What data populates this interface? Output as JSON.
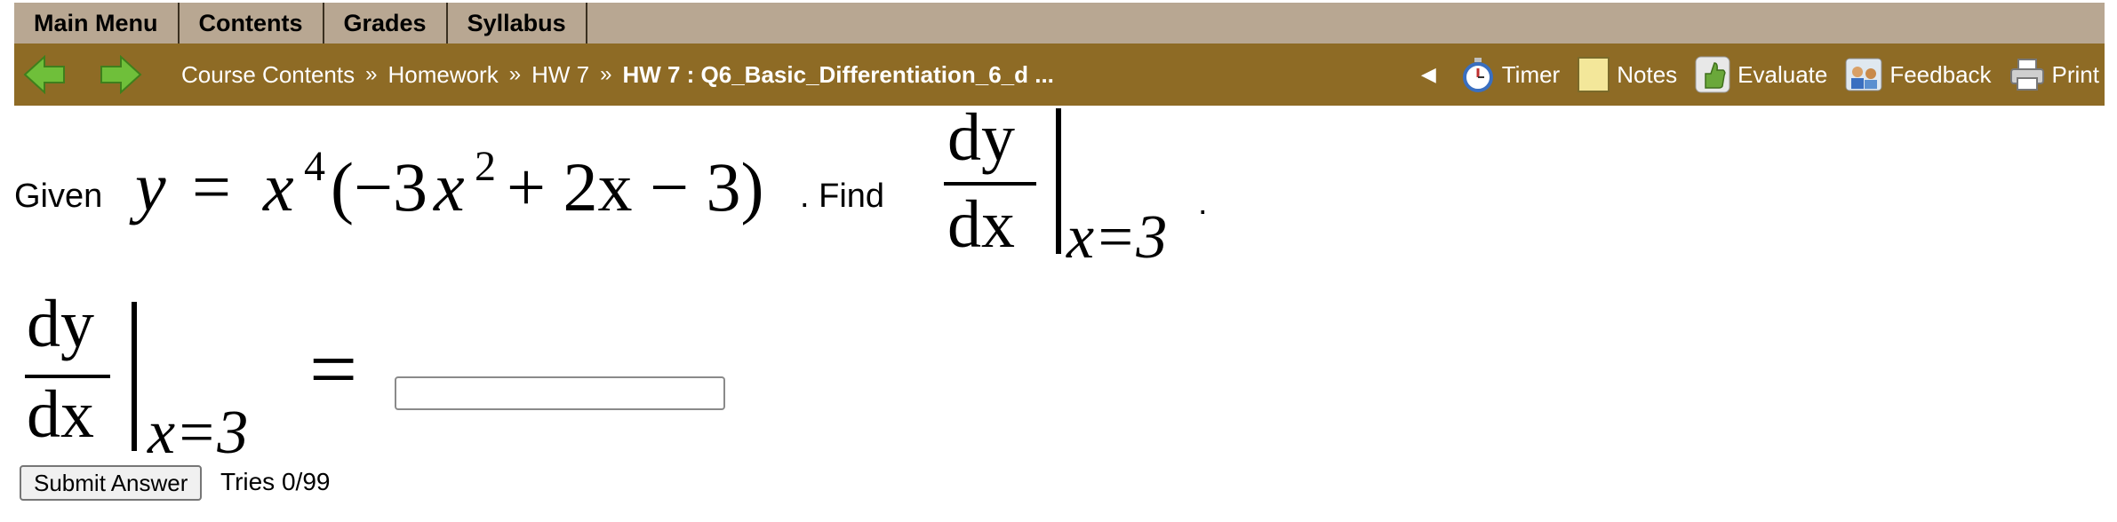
{
  "menu": {
    "items": [
      "Main Menu",
      "Contents",
      "Grades",
      "Syllabus"
    ]
  },
  "nav": {
    "breadcrumbs": [
      "Course Contents",
      "Homework",
      "HW 7"
    ],
    "separator": "»",
    "current": "HW 7 : Q6_Basic_Differentiation_6_d ...",
    "tools": {
      "timer": "Timer",
      "notes": "Notes",
      "evaluate": "Evaluate",
      "feedback": "Feedback",
      "print": "Print"
    }
  },
  "question": {
    "given_label": "Given",
    "find_label": ". Find",
    "period": ".",
    "equation": {
      "lhs": "y",
      "equals": "=",
      "base": "x",
      "exp": "4",
      "open": "(−3",
      "x2": "x",
      "exp2": "2",
      "rest": " + 2x − 3)"
    },
    "derivative": {
      "numerator": "dy",
      "denominator": "dx",
      "evaluated_at": "x=3"
    }
  },
  "answer": {
    "equals": "=",
    "input_value": "",
    "input_placeholder": "",
    "submit_label": "Submit Answer",
    "tries": "Tries 0/99"
  },
  "colors": {
    "menubar": "#b8a792",
    "navbar": "#8e6b25",
    "arrow_green": "#6fbf3a"
  }
}
